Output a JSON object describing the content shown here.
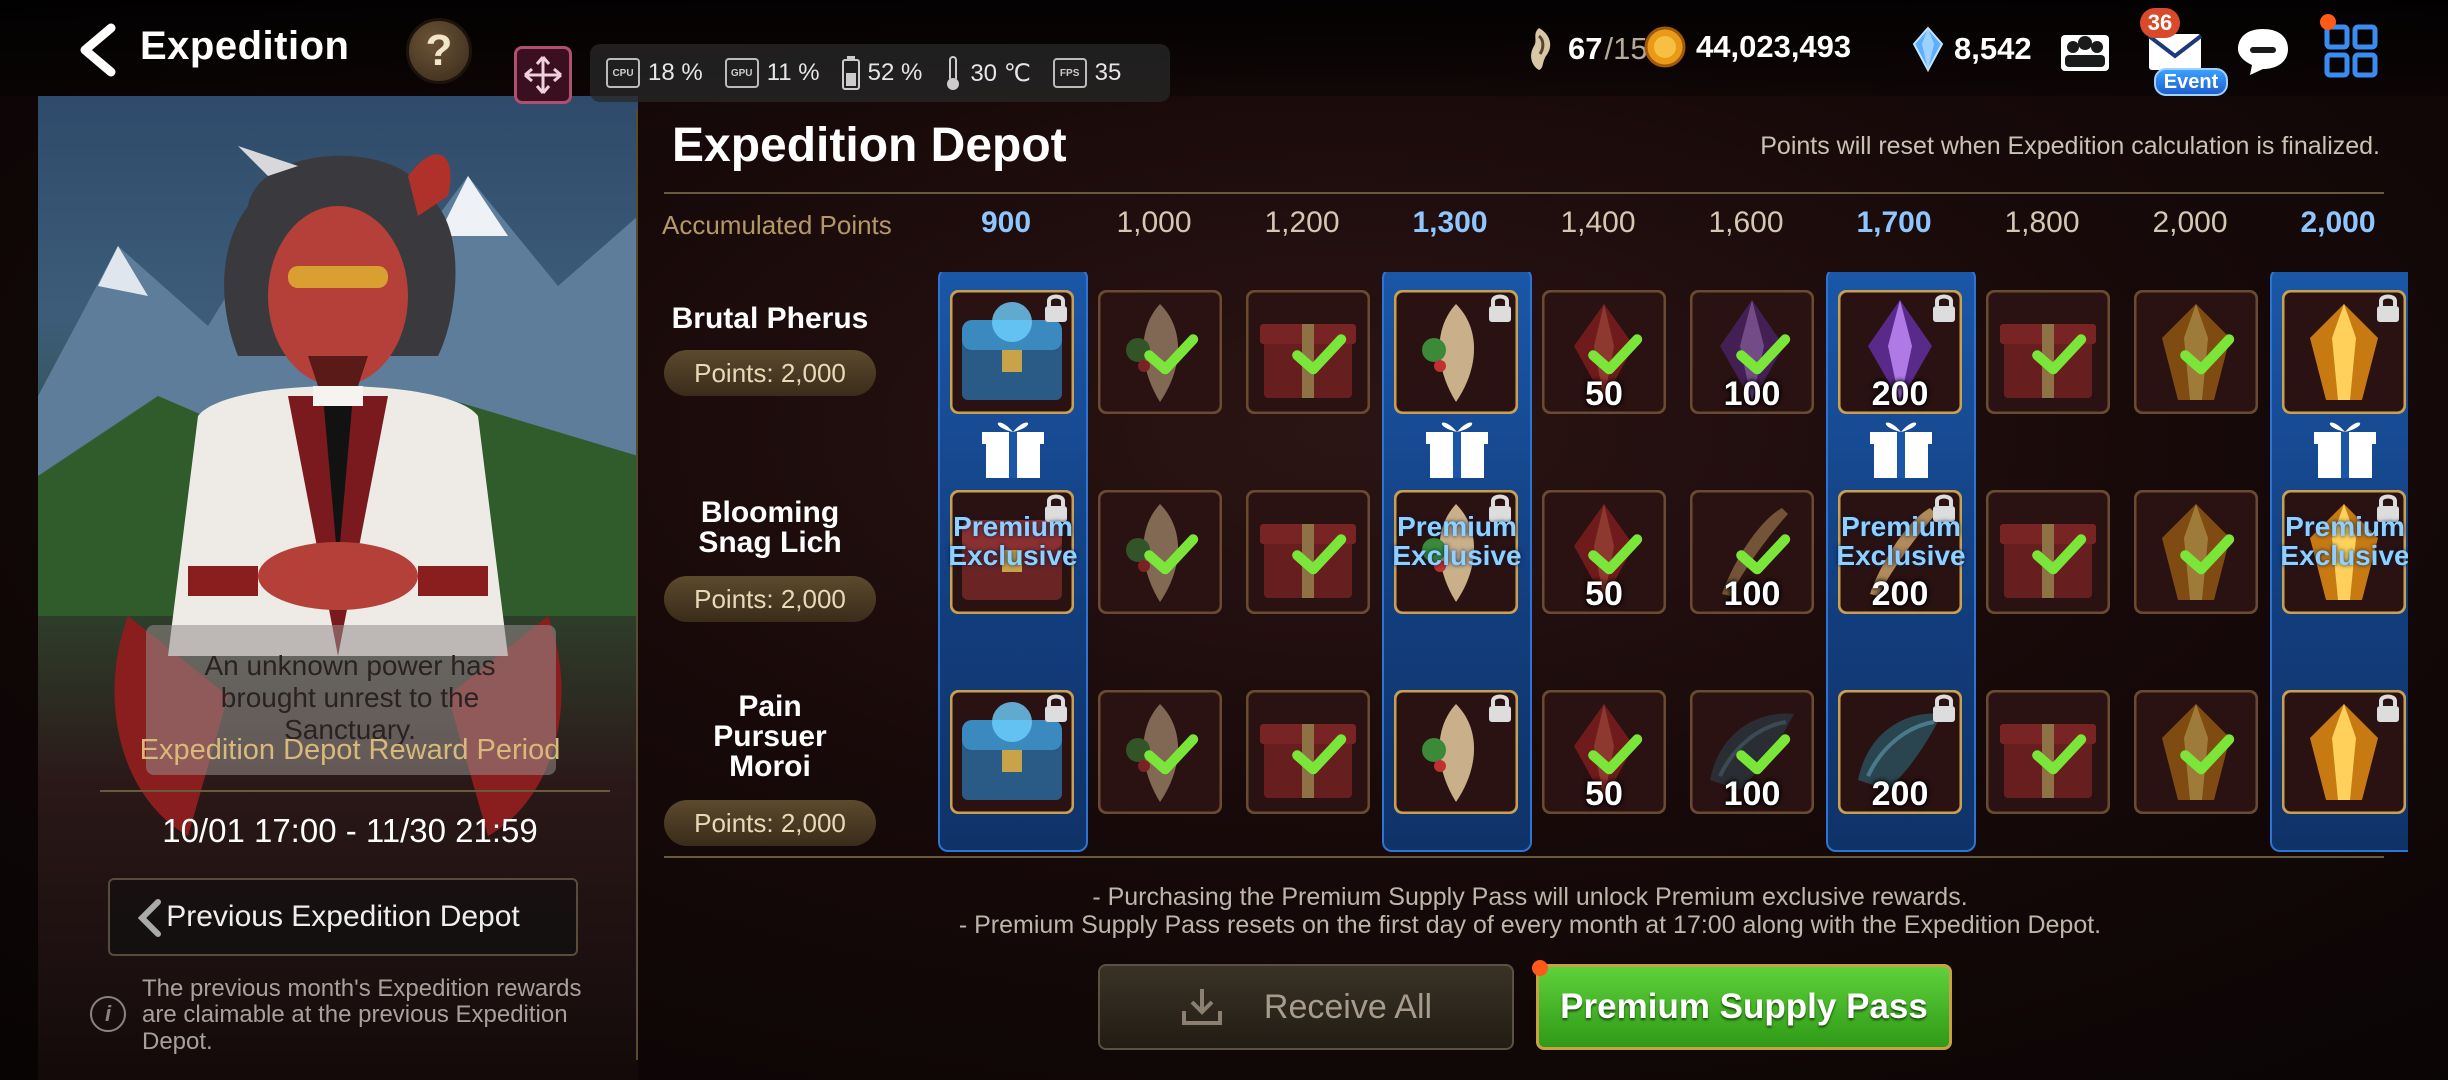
{
  "header": {
    "title": "Expedition",
    "help_glyph": "?"
  },
  "stats": {
    "cpu_chip": "CPU",
    "cpu": "18 %",
    "gpu_chip": "GPU",
    "gpu": "11 %",
    "battery": "52 %",
    "temperature": "30 ℃",
    "fps_chip": "FPS",
    "fps": "35"
  },
  "currencies": {
    "stamina_current": "67",
    "stamina_max": "/150",
    "gold": "44,023,493",
    "crystals": "8,542"
  },
  "mail": {
    "badge_count": "36",
    "event_label": "Event"
  },
  "depot": {
    "title": "Expedition Depot",
    "reset_note": "Points will reset when Expedition calculation is finalized.",
    "accumulated_label": "Accumulated Points",
    "point_thresholds": [
      {
        "value": "900",
        "premium": true
      },
      {
        "value": "1,000",
        "premium": false
      },
      {
        "value": "1,200",
        "premium": false
      },
      {
        "value": "1,300",
        "premium": true
      },
      {
        "value": "1,400",
        "premium": false
      },
      {
        "value": "1,600",
        "premium": false
      },
      {
        "value": "1,700",
        "premium": true
      },
      {
        "value": "1,800",
        "premium": false
      },
      {
        "value": "2,000",
        "premium": false
      },
      {
        "value": "2,000",
        "premium": true
      }
    ],
    "premium_exclusive_label": "Premium\nExclusive",
    "rows": [
      {
        "name": "Brutal Pherus",
        "points": "Points: 2,000",
        "cells": [
          {
            "item": "chest-blue",
            "locked": true,
            "claimed": false,
            "amount": ""
          },
          {
            "item": "feather-leaf",
            "locked": false,
            "claimed": true,
            "amount": ""
          },
          {
            "item": "gift-box-red",
            "locked": false,
            "claimed": true,
            "amount": ""
          },
          {
            "item": "feather-leaf",
            "locked": true,
            "claimed": false,
            "amount": ""
          },
          {
            "item": "red-crystal",
            "locked": false,
            "claimed": true,
            "amount": "50"
          },
          {
            "item": "purple-crystal",
            "locked": false,
            "claimed": true,
            "amount": "100"
          },
          {
            "item": "purple-crystal",
            "locked": true,
            "claimed": false,
            "amount": "200"
          },
          {
            "item": "gift-box-red",
            "locked": false,
            "claimed": true,
            "amount": ""
          },
          {
            "item": "gold-crystal",
            "locked": false,
            "claimed": true,
            "amount": ""
          },
          {
            "item": "gold-crystal",
            "locked": true,
            "claimed": false,
            "amount": ""
          }
        ]
      },
      {
        "name": "Blooming Snag Lich",
        "points": "Points: 2,000",
        "cells": [
          {
            "item": "chest-red",
            "locked": true,
            "claimed": false,
            "amount": ""
          },
          {
            "item": "feather-leaf",
            "locked": false,
            "claimed": true,
            "amount": ""
          },
          {
            "item": "gift-box-red",
            "locked": false,
            "claimed": true,
            "amount": ""
          },
          {
            "item": "feather-leaf",
            "locked": true,
            "claimed": false,
            "amount": ""
          },
          {
            "item": "red-crystal",
            "locked": false,
            "claimed": true,
            "amount": "50"
          },
          {
            "item": "quill",
            "locked": false,
            "claimed": true,
            "amount": "100"
          },
          {
            "item": "quill",
            "locked": true,
            "claimed": false,
            "amount": "200"
          },
          {
            "item": "gift-box-red",
            "locked": false,
            "claimed": true,
            "amount": ""
          },
          {
            "item": "gold-crystal",
            "locked": false,
            "claimed": true,
            "amount": ""
          },
          {
            "item": "gold-crystal",
            "locked": true,
            "claimed": false,
            "amount": ""
          }
        ]
      },
      {
        "name": "Pain Pursuer Moroi",
        "points": "Points: 2,000",
        "cells": [
          {
            "item": "chest-blue",
            "locked": true,
            "claimed": false,
            "amount": ""
          },
          {
            "item": "feather-leaf",
            "locked": false,
            "claimed": true,
            "amount": ""
          },
          {
            "item": "gift-box-red",
            "locked": false,
            "claimed": true,
            "amount": ""
          },
          {
            "item": "feather-leaf",
            "locked": true,
            "claimed": false,
            "amount": ""
          },
          {
            "item": "red-crystal",
            "locked": false,
            "claimed": true,
            "amount": "50"
          },
          {
            "item": "dark-wing",
            "locked": false,
            "claimed": true,
            "amount": "100"
          },
          {
            "item": "dark-wing",
            "locked": true,
            "claimed": false,
            "amount": "200"
          },
          {
            "item": "gift-box-red",
            "locked": false,
            "claimed": true,
            "amount": ""
          },
          {
            "item": "gold-crystal",
            "locked": false,
            "claimed": true,
            "amount": ""
          },
          {
            "item": "gold-crystal",
            "locked": true,
            "claimed": false,
            "amount": ""
          }
        ]
      }
    ],
    "notes": [
      "- Purchasing the Premium Supply Pass will unlock Premium exclusive rewards.",
      "- Premium Supply Pass resets on the first day of every month at 17:00 along with the Expedition Depot."
    ],
    "receive_all": "Receive All",
    "premium_pass": "Premium Supply Pass"
  },
  "left_panel": {
    "info": "An unknown power has brought unrest to the Sanctuary.",
    "period_label": "Expedition Depot Reward Period",
    "period_dates": "10/01 17:00 - 11/30 21:59",
    "prev_button": "Previous Expedition Depot",
    "prev_note": "The previous month's Expedition rewards are claimable at the previous Expedition Depot.",
    "info_glyph": "i"
  },
  "colors": {
    "premium_blue": "#1b57a8",
    "premium_text": "#8fc6ff",
    "check_green": "#7ae63a",
    "pass_green": "#3fb024",
    "accent_gold": "#c7a244"
  }
}
